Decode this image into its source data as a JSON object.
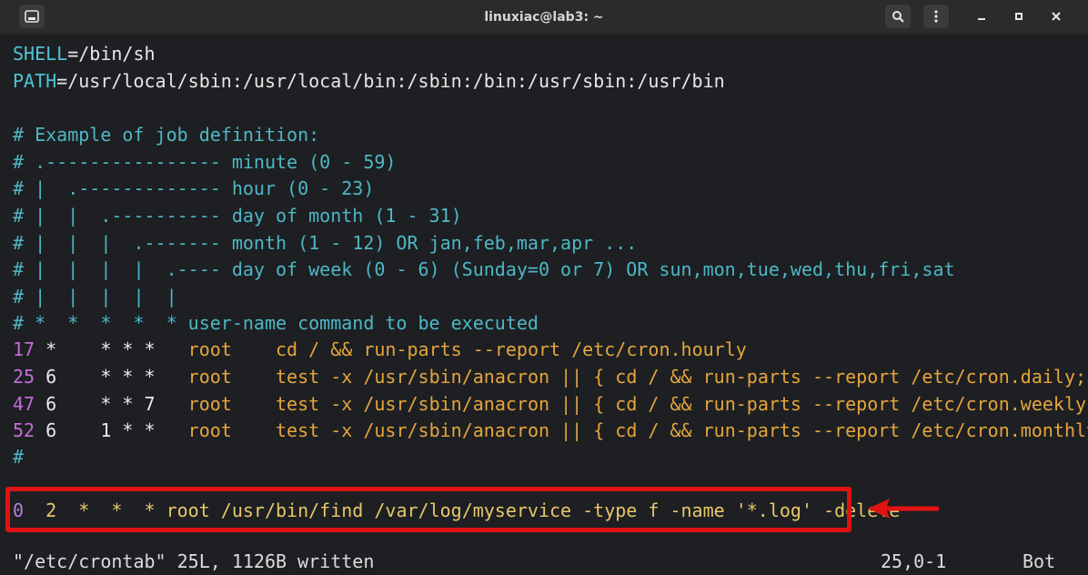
{
  "window": {
    "title": "linuxiac@lab3: ~"
  },
  "lines": {
    "shell": {
      "key": "SHELL",
      "value": "=/bin/sh"
    },
    "path": {
      "key": "PATH",
      "value": "=/usr/local/sbin:/usr/local/bin:/sbin:/bin:/usr/sbin:/usr/bin"
    },
    "comment1": "# Example of job definition:",
    "comment2": "# .---------------- minute (0 - 59)",
    "comment3": "# |  .------------- hour (0 - 23)",
    "comment4": "# |  |  .---------- day of month (1 - 31)",
    "comment5": "# |  |  |  .------- month (1 - 12) OR jan,feb,mar,apr ...",
    "comment6": "# |  |  |  |  .---- day of week (0 - 6) (Sunday=0 or 7) OR sun,mon,tue,wed,thu,fri,sat",
    "comment7": "# |  |  |  |  |",
    "comment8": "# *  *  *  *  * user-name command to be executed",
    "jobs": [
      {
        "min": "17",
        "rest": " *    * * *   ",
        "user": "root",
        "cmd": "    cd / && run-parts --report /etc/cron.hourly"
      },
      {
        "min": "25",
        "rest": " 6    * * *   ",
        "user": "root",
        "cmd": "    test -x /usr/sbin/anacron || { cd / && run-parts --report /etc/cron.daily; }"
      },
      {
        "min": "47",
        "rest": " 6    * * 7   ",
        "user": "root",
        "cmd": "    test -x /usr/sbin/anacron || { cd / && run-parts --report /etc/cron.weekly; }"
      },
      {
        "min": "52",
        "rest": " 6    1 * *   ",
        "user": "root",
        "cmd": "    test -x /usr/sbin/anacron || { cd / && run-parts --report /etc/cron.monthly; }"
      }
    ],
    "hash": "#",
    "new_job": {
      "min": "0",
      "rest": "  2  *  *  * root /usr/bin/find /var/log/myservice -type f -name '*.log' -delete"
    }
  },
  "status": {
    "file_info": "\"/etc/crontab\" 25L, 1126B written",
    "position": "25,0-1",
    "scroll": "Bot"
  },
  "colors": {
    "highlight": "#e01212",
    "comment": "#4eb7c6",
    "text": "#e5a53c"
  },
  "icons": [
    "terminal-icon",
    "search-icon",
    "menu-dots-icon",
    "minimize-icon",
    "maximize-icon",
    "close-icon",
    "arrow-left-icon"
  ]
}
